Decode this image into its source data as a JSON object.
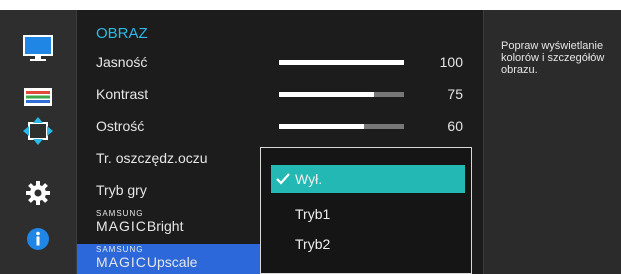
{
  "menu": {
    "title": "OBRAZ",
    "rows": [
      {
        "label": "Jasność",
        "value": "100",
        "level": 1.0
      },
      {
        "label": "Kontrast",
        "value": "75",
        "level": 0.76
      },
      {
        "label": "Ostrość",
        "value": "60",
        "level": 0.68
      },
      {
        "label": "Tr. oszczędz.oczu"
      },
      {
        "label": "Tryb gry"
      },
      {
        "brand_small": "SAMSUNG",
        "brand_big": "MAGIC",
        "label": "Bright"
      },
      {
        "brand_small": "SAMSUNG",
        "brand_big": "MAGIC",
        "label": "Upscale",
        "active": true
      }
    ]
  },
  "dropdown": {
    "options": [
      {
        "label": "Wył.",
        "selected": true
      },
      {
        "label": "Tryb1"
      },
      {
        "label": "Tryb2"
      }
    ]
  },
  "help": {
    "text": "Popraw wyświetlanie\nkolorów i szczegółów\nobrazu."
  },
  "sidebar": {
    "icons": [
      "monitor-icon",
      "color-bars-icon",
      "resize-arrows-icon",
      "gear-icon",
      "info-icon"
    ]
  },
  "colors": {
    "accent_title": "#2bb9e7",
    "active_row": "#2c68d9",
    "selected_option": "#24b8b4"
  }
}
